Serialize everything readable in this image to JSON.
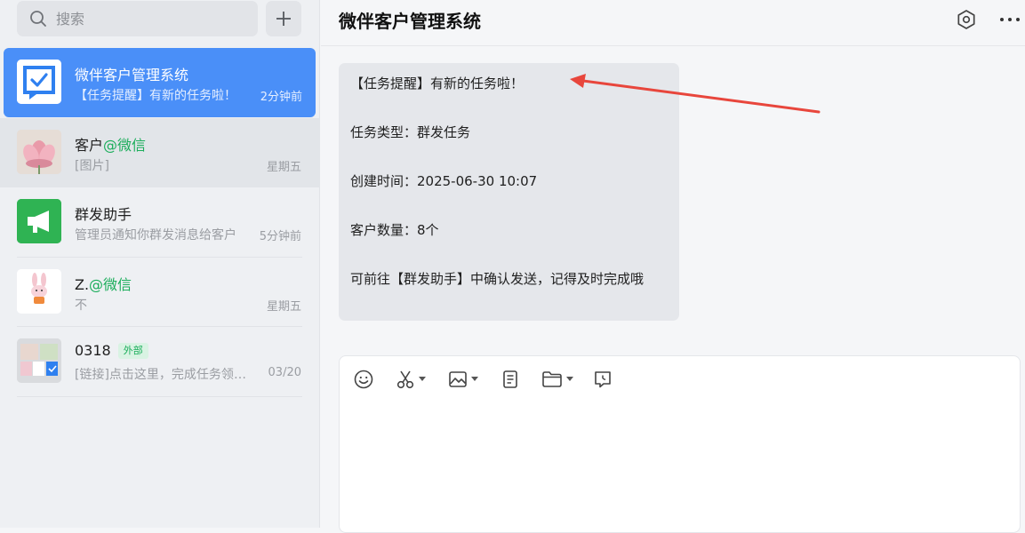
{
  "search": {
    "placeholder": "搜索"
  },
  "conversations": [
    {
      "name": "微伴客户管理系统",
      "suffix": "",
      "preview": "【任务提醒】有新的任务啦！",
      "time": "2分钟前"
    },
    {
      "name": "客户",
      "suffix": "@微信",
      "preview": "[图片]",
      "time": "星期五"
    },
    {
      "name": "群发助手",
      "suffix": "",
      "preview": "管理员通知你群发消息给客户",
      "time": "5分钟前"
    },
    {
      "name": "Z.",
      "suffix": "@微信",
      "preview": "不",
      "time": "星期五"
    },
    {
      "name": "0318",
      "badge": "外部",
      "preview": "[链接]点击这里，完成任务领取奖励",
      "time": "03/20"
    }
  ],
  "header": {
    "title": "微伴客户管理系统"
  },
  "message": {
    "line1": "【任务提醒】有新的任务啦！",
    "line2": "任务类型：群发任务",
    "line3": "创建时间：2025-06-30 10:07",
    "line4": "客户数量：8个",
    "line5": "可前往【群发助手】中确认发送，记得及时完成哦"
  },
  "toolbar": {
    "icons": [
      "emoji-icon",
      "scissors-icon",
      "image-icon",
      "document-icon",
      "folder-icon",
      "chat-history-icon"
    ]
  },
  "colors": {
    "accent": "#4a8ff8",
    "wechat_green": "#1aad5a",
    "annotation_arrow": "#e8463c"
  }
}
